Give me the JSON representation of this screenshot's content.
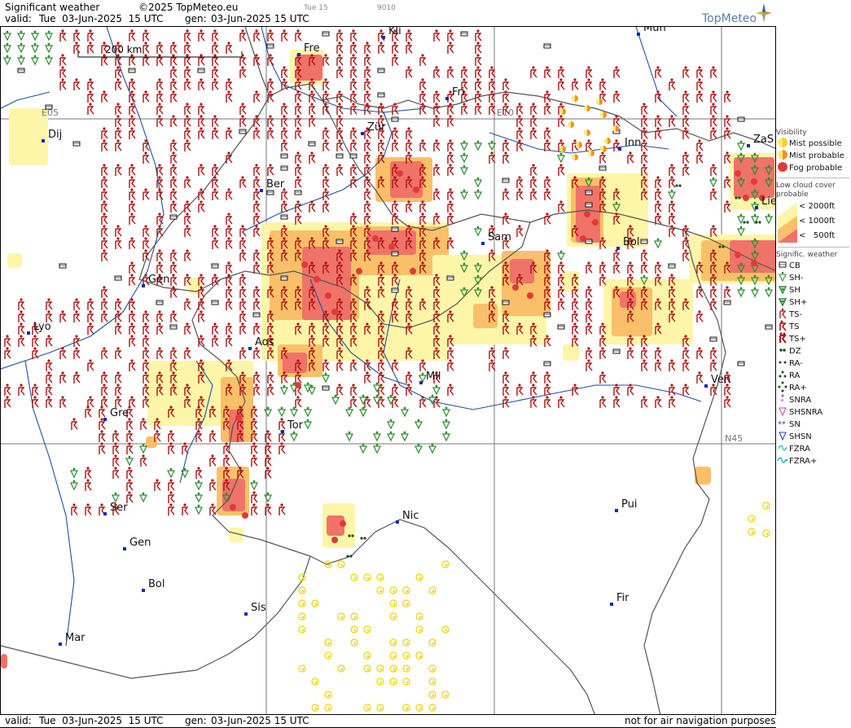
{
  "header": {
    "title": "Significant weather",
    "copyright": "©2025 TopMeteo.eu",
    "time_label": "Tue 15",
    "code": "9010",
    "valid_label": "valid:",
    "valid_value": "Tue  03-Jun-2025  15 UTC",
    "gen_label": "gen:",
    "gen_value": "03-Jun-2025 15 UTC",
    "logo": "TopMeteo"
  },
  "footer": {
    "valid_label": "valid:",
    "valid_value": "Tue  03-Jun-2025  15 UTC",
    "gen_label": "gen:",
    "gen_value": "03-Jun-2025 15 UTC",
    "disclaimer": "not for air navigation purposes"
  },
  "map": {
    "scale_label": "200 km",
    "grid_labels": {
      "e05": "E05",
      "e10": "E10",
      "n45": "N45"
    },
    "cities": [
      {
        "name": "Fre"
      },
      {
        "name": "Kli"
      },
      {
        "name": "Mun"
      },
      {
        "name": "Fri"
      },
      {
        "name": "Dij"
      },
      {
        "name": "Zür"
      },
      {
        "name": "Inn"
      },
      {
        "name": "ZaS"
      },
      {
        "name": "Ber"
      },
      {
        "name": "Lie"
      },
      {
        "name": "Sam"
      },
      {
        "name": "Bol"
      },
      {
        "name": "Gen"
      },
      {
        "name": "Lyo"
      },
      {
        "name": "Aos"
      },
      {
        "name": "Mil"
      },
      {
        "name": "Ven"
      },
      {
        "name": "Gre"
      },
      {
        "name": "Tor"
      },
      {
        "name": "Ser"
      },
      {
        "name": "Gen"
      },
      {
        "name": "Bol"
      },
      {
        "name": "Sis"
      },
      {
        "name": "Pui"
      },
      {
        "name": "Nic"
      },
      {
        "name": "Fir"
      },
      {
        "name": "Mar"
      }
    ]
  },
  "legend": {
    "visibility_title": "Visibility",
    "visibility": [
      "Mist possible",
      "Mist probable",
      "Fog probable"
    ],
    "lowcloud_title": "Low cloud cover probable",
    "lowcloud": [
      "< 2000ft",
      "< 1000ft",
      "<   500ft"
    ],
    "sigwx_title": "Signific. weather",
    "sigwx": [
      "CB",
      "SH-",
      "SH",
      "SH+",
      "TS-",
      "TS",
      "TS+",
      "DZ",
      "RA-",
      "RA",
      "RA+",
      "SNRA",
      "SHSNRA",
      "SN",
      "SHSN",
      "FZRA",
      "FZRA+"
    ]
  },
  "colors": {
    "mist_possible": "#fde978",
    "mist_probable": "#f78f1e",
    "fog_probable": "#e2393a",
    "cloud_2000": "#fdf6a8",
    "cloud_1000": "#f9c069",
    "cloud_500": "#f0736a",
    "ts": "#b01010",
    "sh": "#2e8b2e",
    "river": "#1f4fa0",
    "border": "#505050",
    "grid": "#777777"
  }
}
